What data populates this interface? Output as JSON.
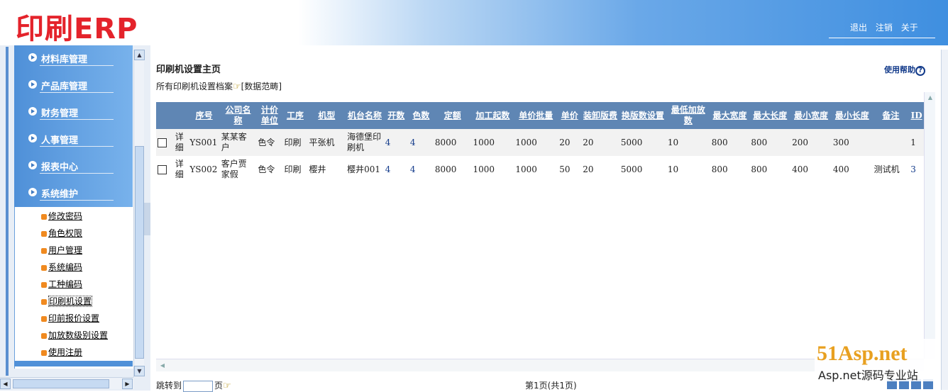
{
  "app": {
    "logo": "印刷ERP",
    "top_links": [
      "退出",
      "注销",
      "关于"
    ]
  },
  "sidebar": {
    "menu": [
      {
        "label": "材料库管理"
      },
      {
        "label": "产品库管理"
      },
      {
        "label": "财务管理"
      },
      {
        "label": "人事管理"
      },
      {
        "label": "报表中心"
      },
      {
        "label": "系统维护"
      }
    ],
    "submenu": [
      {
        "label": "修改密码"
      },
      {
        "label": "角色权限"
      },
      {
        "label": "用户管理"
      },
      {
        "label": "系统编码"
      },
      {
        "label": "工种编码"
      },
      {
        "label": "印刷机设置",
        "active": true
      },
      {
        "label": "印前报价设置"
      },
      {
        "label": "加放数级别设置"
      },
      {
        "label": "使用注册"
      }
    ]
  },
  "main": {
    "title": "印刷机设置主页",
    "help": "使用帮助",
    "subtitle": "所有印刷机设置档案",
    "data_range": "[数据范畴]"
  },
  "table": {
    "columns": [
      "序号",
      "公司名称",
      "计价单位",
      "工序",
      "机型",
      "机台名称",
      "开数",
      "色数",
      "定额",
      "加工起数",
      "单价批量",
      "单价",
      "装卸版费",
      "换版数设置",
      "最低加放数",
      "最大宽度",
      "最大长度",
      "最小宽度",
      "最小长度",
      "备注",
      "ID"
    ],
    "detail_label": "详细",
    "rows": [
      {
        "seq": "YS001",
        "company": "某某客户",
        "unit": "色令",
        "process": "印刷",
        "model": "平张机",
        "machine": "海德堡印刷机",
        "kai": "4",
        "colors": "4",
        "quota": "8000",
        "start_qty": "1000",
        "batch": "1000",
        "price": "20",
        "plate_fee": "20",
        "plate_set": "5000",
        "min_extra": "10",
        "max_w": "800",
        "max_l": "800",
        "min_w": "200",
        "min_l": "300",
        "note": "",
        "id": "1"
      },
      {
        "seq": "YS002",
        "company": "客户贾家假",
        "unit": "色令",
        "process": "印刷",
        "model": "樱井",
        "machine": "樱井001",
        "kai": "4",
        "colors": "4",
        "quota": "8000",
        "start_qty": "1000",
        "batch": "1000",
        "price": "50",
        "plate_fee": "20",
        "plate_set": "5000",
        "min_extra": "10",
        "max_w": "800",
        "max_l": "800",
        "min_w": "400",
        "min_l": "400",
        "note": "测试机",
        "id": "3"
      }
    ]
  },
  "pager": {
    "jump_label": "跳转到",
    "page_unit": "页",
    "info": "第1页(共1页)"
  },
  "watermark": {
    "brand": "51Asp.net",
    "slogan": "Asp.net源码专业站"
  },
  "colors": {
    "logo_red": "#e4232b",
    "menu_blue": "#4f90d8",
    "table_header": "#5f86b4"
  }
}
